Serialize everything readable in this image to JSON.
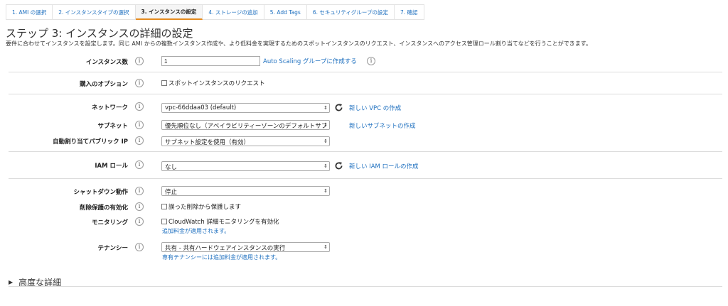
{
  "tabs": [
    {
      "label": "1. AMI の選択"
    },
    {
      "label": "2. インスタンスタイプの選択"
    },
    {
      "label": "3. インスタンスの設定"
    },
    {
      "label": "4. ストレージの追加"
    },
    {
      "label": "5. Add Tags"
    },
    {
      "label": "6. セキュリティグループの設定"
    },
    {
      "label": "7. 確認"
    }
  ],
  "active_tab": 2,
  "page": {
    "title": "ステップ 3: インスタンスの詳細の設定",
    "description": "要件に合わせてインスタンスを設定します。同じ AMI からの複数インスタンス作成や、より低料金を実現するためのスポットインスタンスのリクエスト、インスタンスへのアクセス管理ロール割り当てなどを行うことができます。"
  },
  "info_glyph": "i",
  "form": {
    "instance_count": {
      "label": "インスタンス数",
      "value": "1",
      "link": "Auto Scaling グループに作成する"
    },
    "purchase_option": {
      "label": "購入のオプション",
      "checkbox_label": "スポットインスタンスのリクエスト"
    },
    "network": {
      "label": "ネットワーク",
      "value": "vpc-66ddaa03 (default)",
      "link": "新しい VPC の作成"
    },
    "subnet": {
      "label": "サブネット",
      "value": "優先順位なし（アベイラビリティーゾーンのデフォルトサブネット）",
      "link": "新しいサブネットの作成"
    },
    "public_ip": {
      "label": "自動割り当てパブリック IP",
      "value": "サブネット設定を使用（有効）"
    },
    "iam_role": {
      "label": "IAM ロール",
      "value": "なし",
      "link": "新しい IAM ロールの作成"
    },
    "shutdown": {
      "label": "シャットダウン動作",
      "value": "停止"
    },
    "termination_protection": {
      "label": "削除保護の有効化",
      "checkbox_label": "誤った削除から保護します"
    },
    "monitoring": {
      "label": "モニタリング",
      "checkbox_label": "CloudWatch 詳細モニタリングを有効化",
      "note": "追加料金が適用されます。"
    },
    "tenancy": {
      "label": "テナンシー",
      "value": "共有 - 共有ハードウェアインスタンスの実行",
      "note": "専有テナンシーには追加料金が適用されます。"
    }
  },
  "advanced": {
    "label": "高度な詳細"
  },
  "colors": {
    "link": "#1d6fbf",
    "active_tab_underline": "#e58b1e",
    "divider": "#dcdcdc"
  }
}
